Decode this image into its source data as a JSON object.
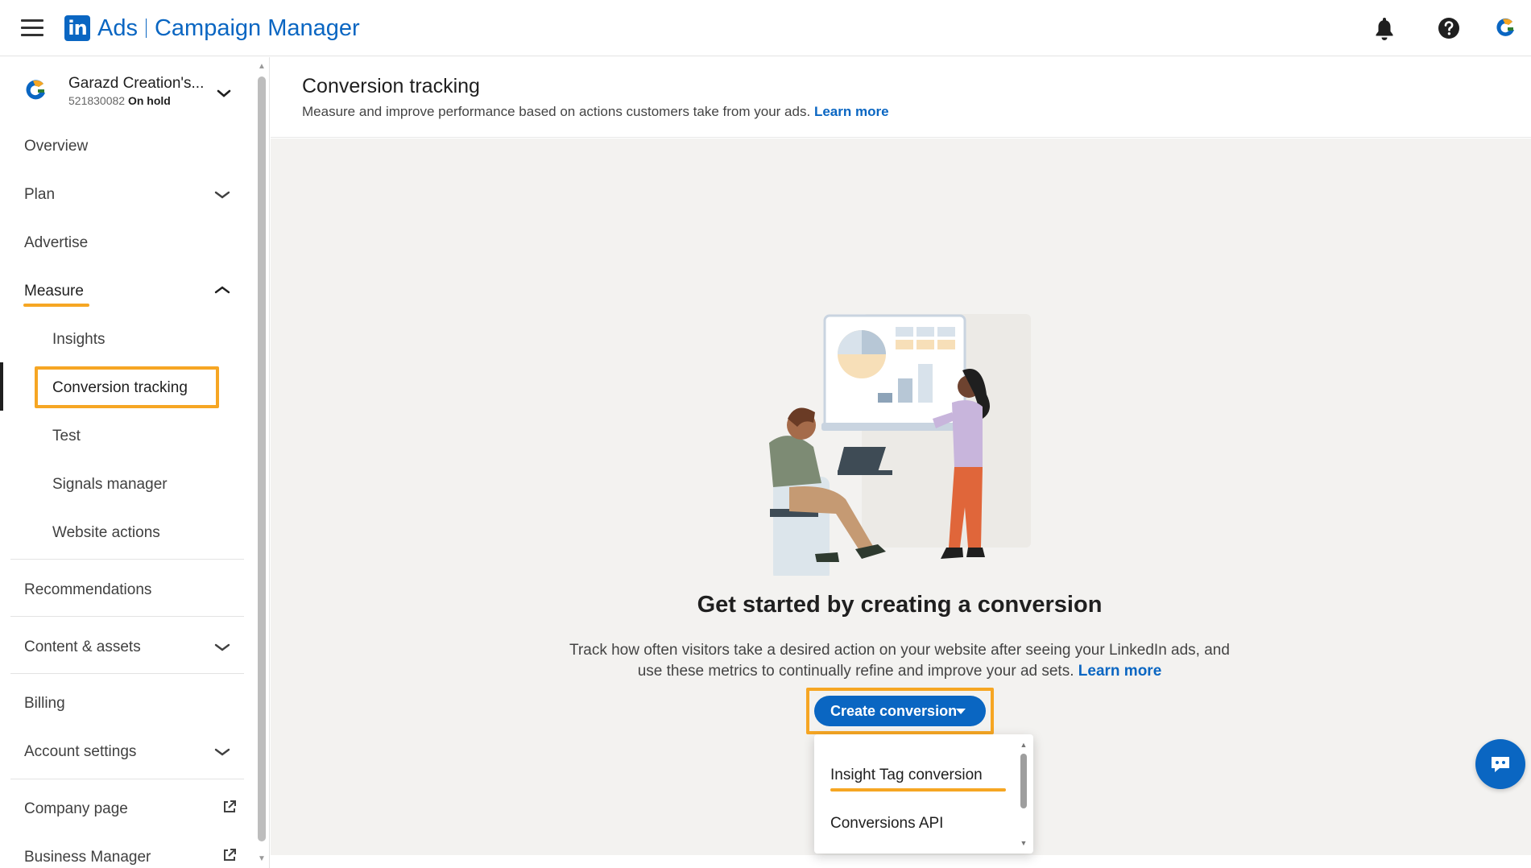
{
  "topbar": {
    "logo_text": "in",
    "ads_label": "Ads",
    "product_name": "Campaign Manager"
  },
  "account": {
    "name": "Garazd Creation's...",
    "id": "521830082",
    "status": "On hold"
  },
  "nav": {
    "overview": "Overview",
    "plan": "Plan",
    "advertise": "Advertise",
    "measure": "Measure",
    "insights": "Insights",
    "conversion_tracking": "Conversion tracking",
    "test": "Test",
    "signals_manager": "Signals manager",
    "website_actions": "Website actions",
    "recommendations": "Recommendations",
    "content_assets": "Content & assets",
    "billing": "Billing",
    "account_settings": "Account settings",
    "company_page": "Company page",
    "business_manager": "Business Manager"
  },
  "header": {
    "title": "Conversion tracking",
    "subtitle": "Measure and improve performance based on actions customers take from your ads.",
    "learn_more": "Learn more"
  },
  "empty_state": {
    "title": "Get started by creating a conversion",
    "description": "Track how often visitors take a desired action on your website after seeing your LinkedIn ads, and use these metrics to continually refine and improve your ad sets.",
    "learn_more": "Learn more"
  },
  "create_button": {
    "label": "Create conversion"
  },
  "dropdown": {
    "items": [
      "Insight Tag conversion",
      "Conversions API"
    ]
  },
  "colors": {
    "brand": "#0a66c2",
    "highlight": "#f6a623",
    "background": "#f3f2f0"
  }
}
